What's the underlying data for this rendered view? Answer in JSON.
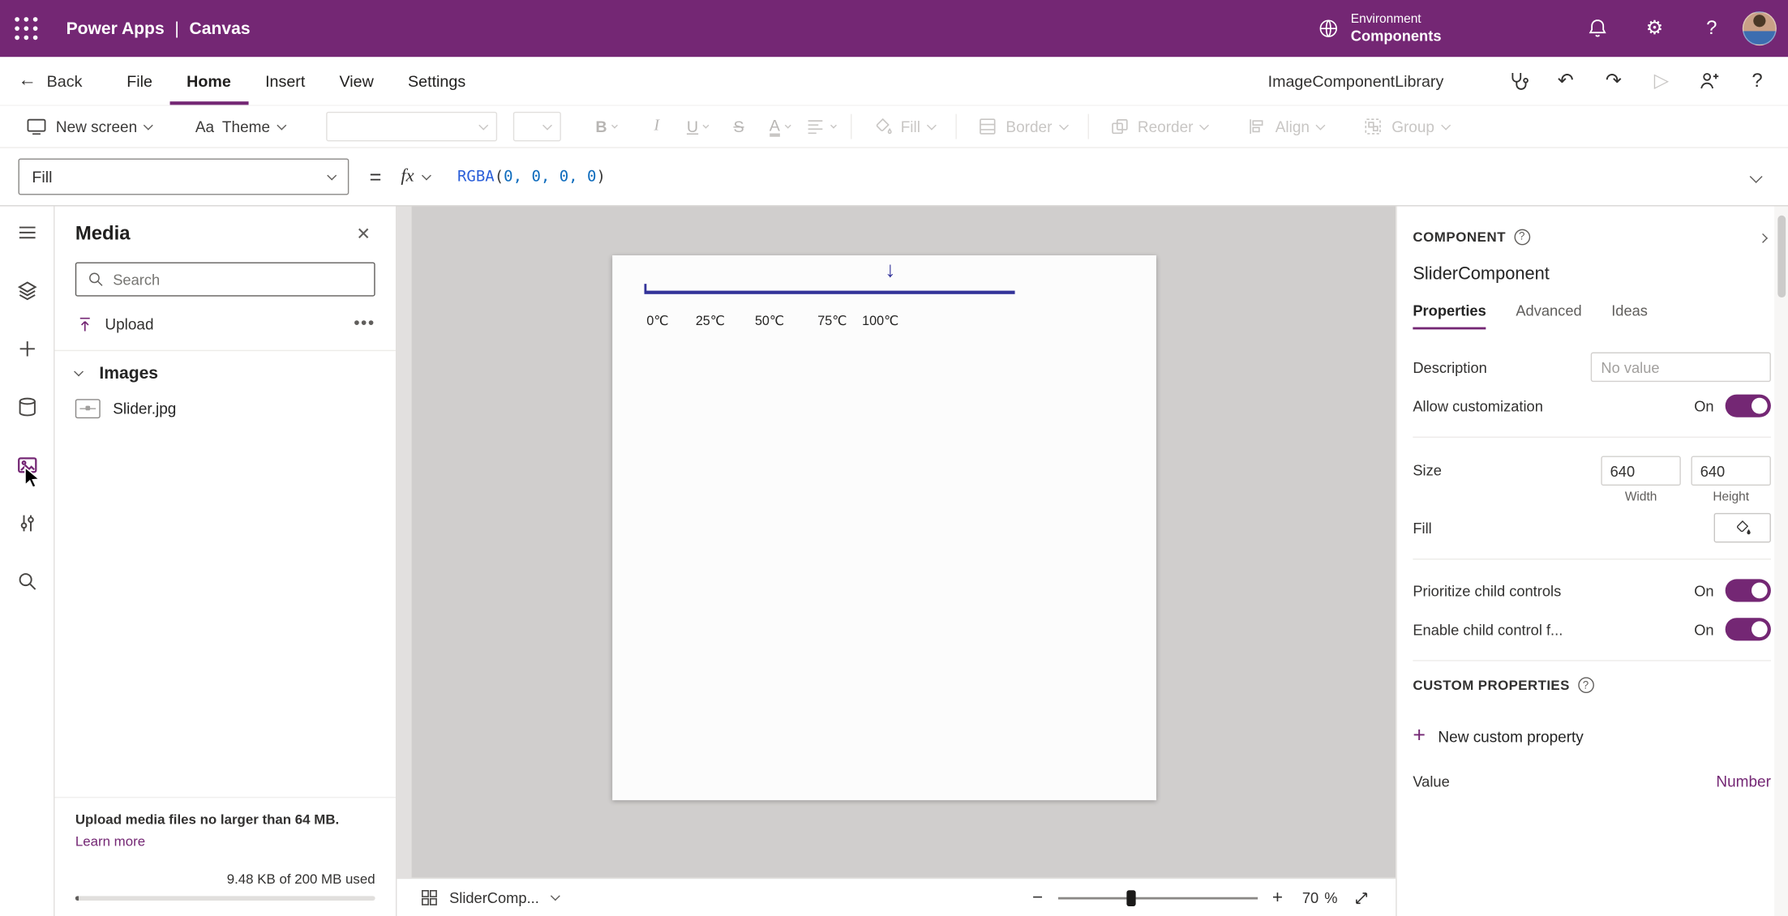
{
  "colors": {
    "brand": "#742774",
    "toggle_on": "#742774",
    "slider_line": "#333399",
    "code_function": "#2b5fd9",
    "code_number": "#0f6cbd"
  },
  "icons": {
    "back": "←",
    "undo": "↶",
    "redo": "↷",
    "play": "▷",
    "help": "?",
    "gear": "⚙",
    "close": "✕",
    "more": "•••",
    "theme": "Aa",
    "bold": "B",
    "italic": "I",
    "underline": "U",
    "strikethrough": "S",
    "text_color": "A",
    "minus": "−",
    "plus": "+",
    "down_arrow": "↓"
  },
  "top_bar": {
    "app_name": "Power Apps",
    "divider": "|",
    "doc_name": "Canvas",
    "environment_label": "Environment",
    "environment_name": "Components"
  },
  "menu_bar": {
    "back": "Back",
    "items": [
      "File",
      "Home",
      "Insert",
      "View",
      "Settings"
    ],
    "library_name": "ImageComponentLibrary"
  },
  "toolbar": {
    "new_screen": "New screen",
    "theme": "Theme",
    "fill": "Fill",
    "border": "Border",
    "reorder": "Reorder",
    "align": "Align",
    "group": "Group"
  },
  "formula_bar": {
    "property": "Fill",
    "equals": "=",
    "fx": "fx",
    "fn": "RGBA",
    "open_paren": "(",
    "args": "0, 0, 0, 0",
    "close_paren": ")"
  },
  "media_panel": {
    "title": "Media",
    "search_placeholder": "Search",
    "upload": "Upload",
    "section_title": "Images",
    "items": [
      {
        "name": "Slider.jpg"
      }
    ],
    "footer_note": "Upload media files no larger than 64 MB.",
    "learn_more": "Learn more",
    "usage": "9.48 KB of 200 MB used"
  },
  "canvas": {
    "ticks": [
      "0℃",
      "25℃",
      "50℃",
      "75℃",
      "100℃"
    ]
  },
  "status_bar": {
    "component": "SliderComp...",
    "zoom": "70",
    "percent": "%"
  },
  "properties_panel": {
    "header": "COMPONENT",
    "component_name": "SliderComponent",
    "tabs": [
      "Properties",
      "Advanced",
      "Ideas"
    ],
    "description_label": "Description",
    "description_placeholder": "No value",
    "allow_customization_label": "Allow customization",
    "allow_customization_state": "On",
    "size_label": "Size",
    "width_value": "640",
    "height_value": "640",
    "width_label": "Width",
    "height_label": "Height",
    "fill_label": "Fill",
    "prioritize_label": "Prioritize child controls",
    "prioritize_state": "On",
    "enable_child_label": "Enable child control f...",
    "enable_child_state": "On",
    "custom_properties_header": "CUSTOM PROPERTIES",
    "new_custom_property": "New custom property",
    "value_label": "Value",
    "value_type": "Number"
  }
}
